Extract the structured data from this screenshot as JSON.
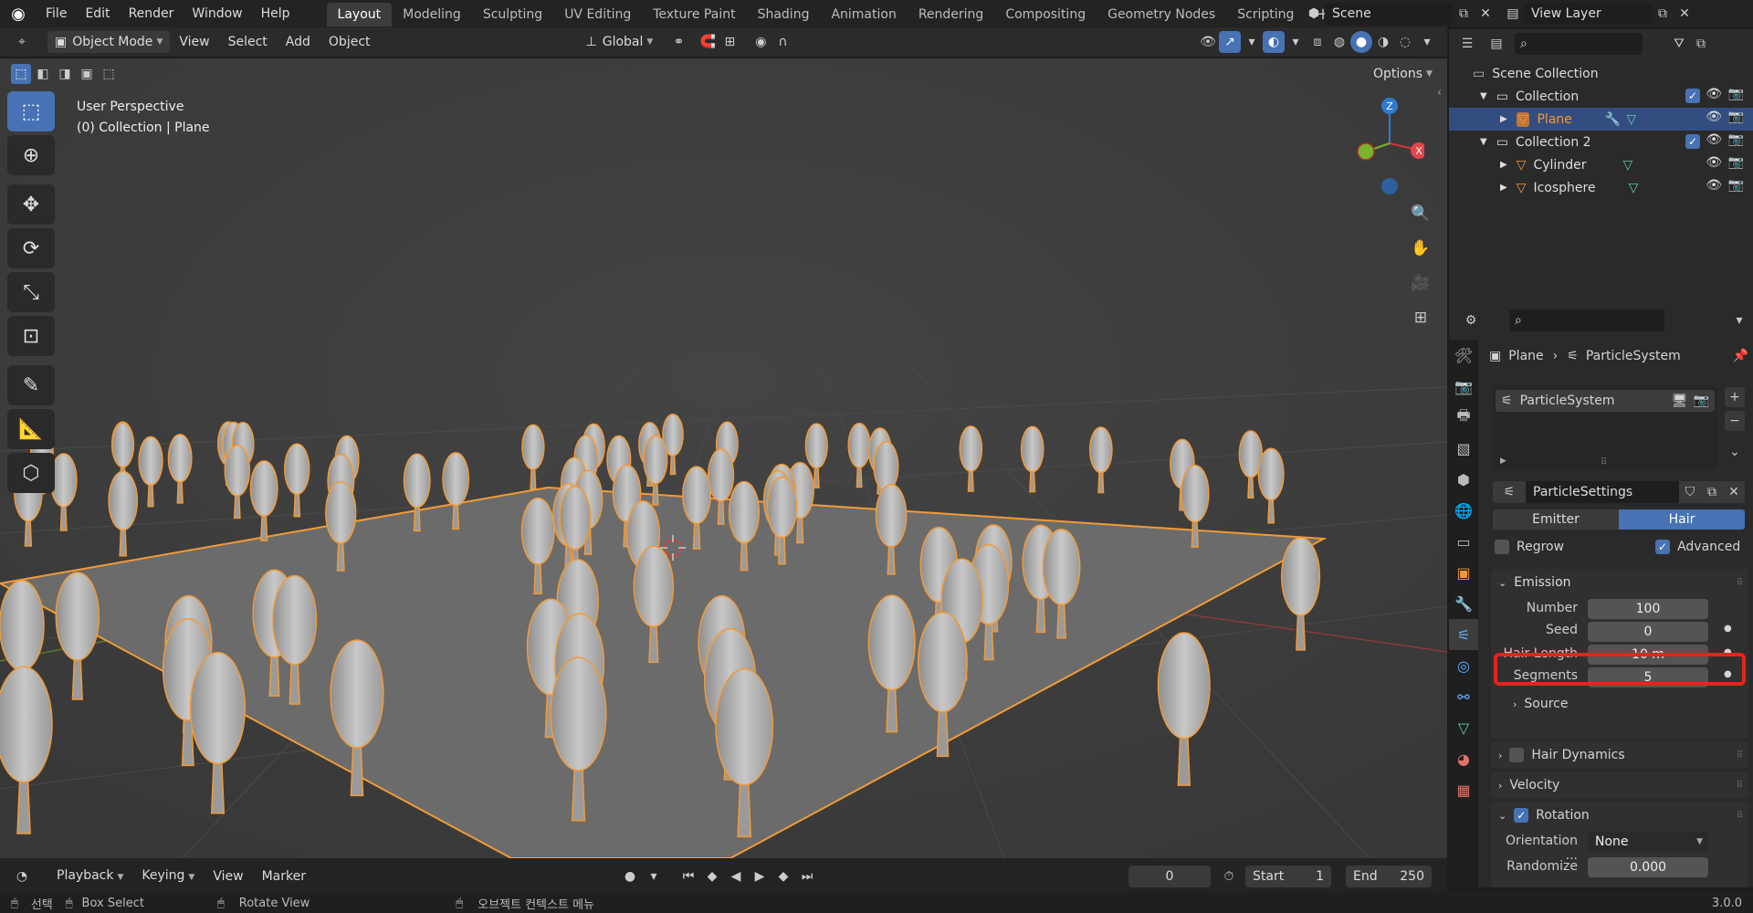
{
  "app": {
    "version": "3.0.0"
  },
  "menu": [
    "File",
    "Edit",
    "Render",
    "Window",
    "Help"
  ],
  "workspaces": [
    "Layout",
    "Modeling",
    "Sculpting",
    "UV Editing",
    "Texture Paint",
    "Shading",
    "Animation",
    "Rendering",
    "Compositing",
    "Geometry Nodes",
    "Scripting"
  ],
  "scene": {
    "name": "Scene",
    "view_layer": "View Layer"
  },
  "viewport_header": {
    "mode": "Object Mode",
    "menus": [
      "View",
      "Select",
      "Add",
      "Object"
    ],
    "orientation": "Global",
    "options": "Options"
  },
  "viewport": {
    "perspective": "User Perspective",
    "context": "(0) Collection | Plane",
    "gizmo": {
      "z": "Z",
      "x": "X"
    }
  },
  "outliner": {
    "root": "Scene Collection",
    "rows": [
      {
        "label": "Collection",
        "indent": 1
      },
      {
        "label": "Plane",
        "indent": 2,
        "selected": true
      },
      {
        "label": "Collection 2",
        "indent": 1
      },
      {
        "label": "Cylinder",
        "indent": 2
      },
      {
        "label": "Icosphere",
        "indent": 2
      }
    ]
  },
  "properties": {
    "breadcrumb": {
      "object": "Plane",
      "system": "ParticleSystem"
    },
    "system_name": "ParticleSystem",
    "settings_name": "ParticleSettings",
    "type_tabs": {
      "emitter": "Emitter",
      "hair": "Hair"
    },
    "regrow": "Regrow",
    "advanced": "Advanced",
    "emission": {
      "title": "Emission",
      "number_label": "Number",
      "number_value": "100",
      "seed_label": "Seed",
      "seed_value": "0",
      "hair_length_label": "Hair Length",
      "hair_length_value": "10 m",
      "segments_label": "Segments",
      "segments_value": "5"
    },
    "source": "Source",
    "hair_dynamics": "Hair Dynamics",
    "velocity": "Velocity",
    "rotation": "Rotation",
    "orientation_label": "Orientation ...",
    "orientation_value": "None",
    "randomize_label": "Randomize",
    "randomize_value": "0.000"
  },
  "timeline": {
    "menus": [
      "Playback",
      "Keying",
      "View",
      "Marker"
    ],
    "frame": "0",
    "start_label": "Start",
    "start_value": "1",
    "end_label": "End",
    "end_value": "250"
  },
  "status": {
    "select": "선택",
    "box_select": "Box Select",
    "rotate": "Rotate View",
    "context_menu": "오브젝트 컨텍스트 메뉴"
  },
  "colors": {
    "accent": "#4772b3",
    "highlight": "#e8231c",
    "selection_outline": "#f29a38"
  }
}
